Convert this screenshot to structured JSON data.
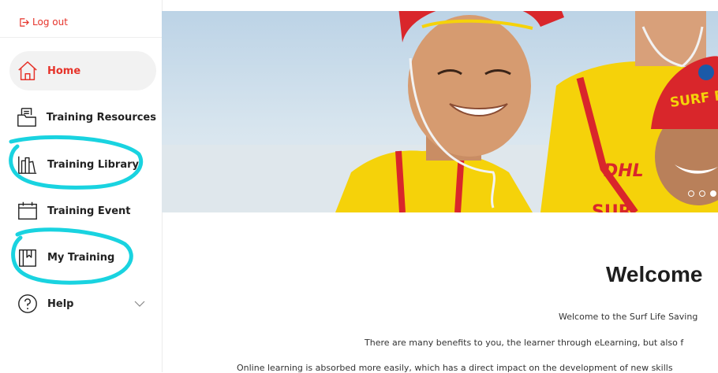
{
  "sidebar": {
    "logout_label": "Log out",
    "items": [
      {
        "label": "Home",
        "icon": "home-icon",
        "active": true
      },
      {
        "label": "Training Resources",
        "icon": "folder-icon"
      },
      {
        "label": "Training Library",
        "icon": "library-icon"
      },
      {
        "label": "Training Event",
        "icon": "calendar-icon"
      },
      {
        "label": "My Training",
        "icon": "bookmark-book-icon"
      },
      {
        "label": "Help",
        "icon": "help-circle-icon",
        "expandable": true
      }
    ]
  },
  "hero": {
    "cap_text": "SURF RE",
    "shirt_text": "DHL",
    "shirt_text_lower": "SUR",
    "carousel_dots": 3,
    "active_dot": 3
  },
  "content": {
    "title": "Welcome",
    "paragraphs": [
      "Welcome to the Surf Life Saving",
      "There are many benefits to you, the learner through eLearning, but also f",
      "Online learning is absorbed more easily, which has a direct impact on the development of new skills"
    ]
  },
  "colors": {
    "accent": "#e6332a",
    "highlight": "#19d3e0",
    "uniform_yellow": "#f5d20a",
    "cap_red": "#d9262b"
  }
}
